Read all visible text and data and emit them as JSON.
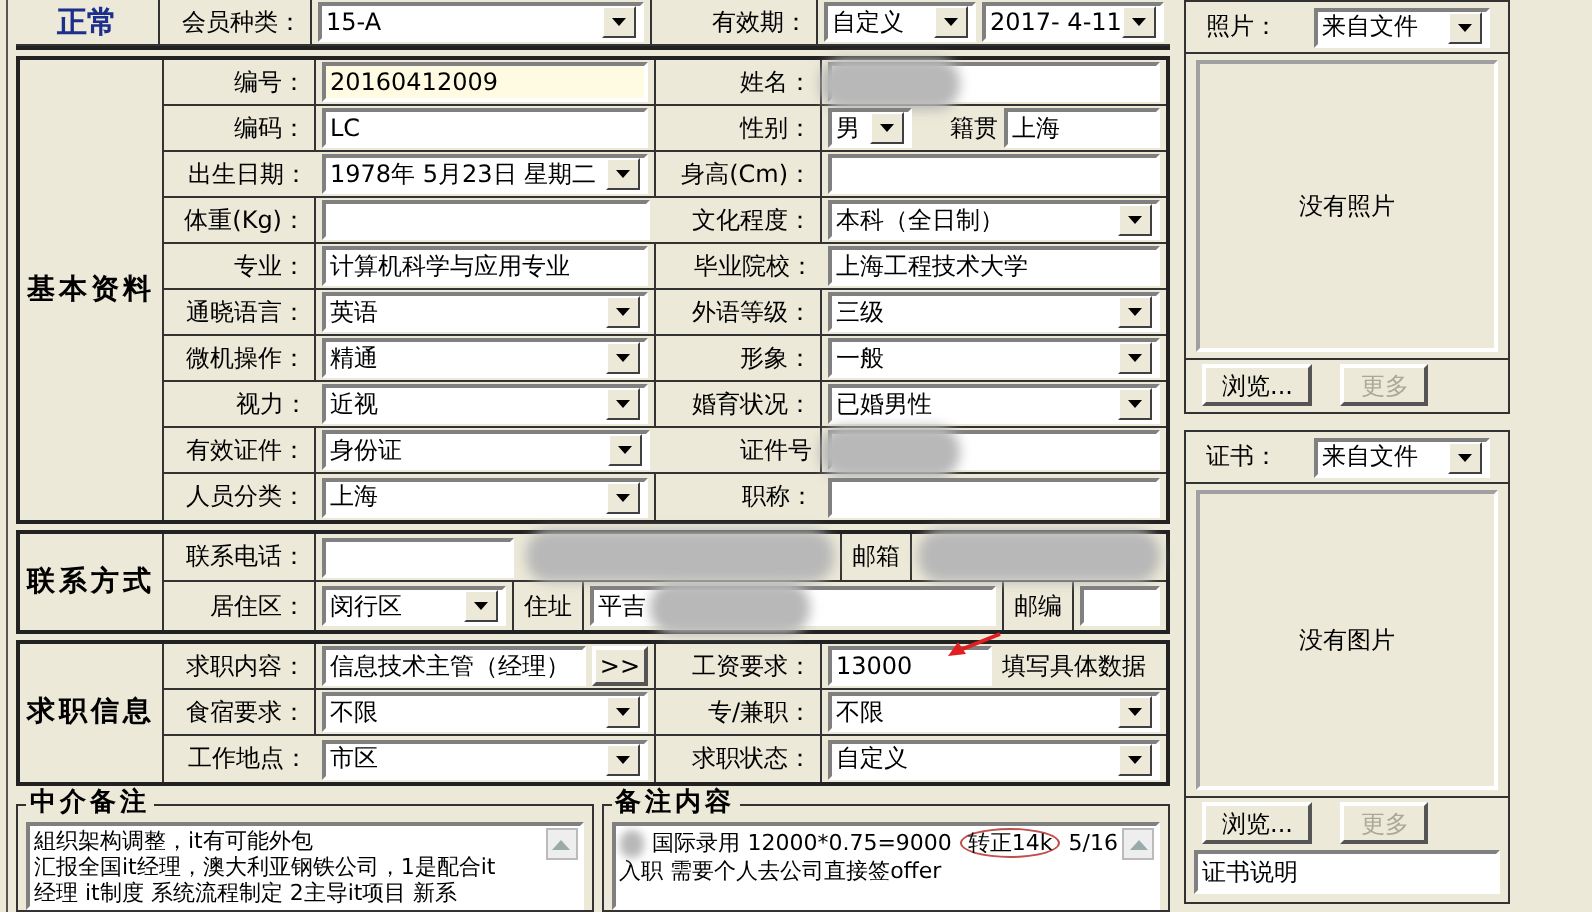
{
  "status": "正常",
  "membership": {
    "label": "会员种类：",
    "value": "15-A"
  },
  "validity": {
    "label": "有效期：",
    "type": "自定义",
    "date": "2017- 4-11"
  },
  "basic": {
    "title": "基本资料",
    "rows": [
      [
        {
          "label": "编号：",
          "kind": "active_text",
          "value": "20160412009"
        },
        {
          "label": "姓名：",
          "kind": "blurred"
        }
      ],
      [
        {
          "label": "编码：",
          "kind": "text",
          "value": "LC"
        },
        {
          "label": "性别：",
          "kind": "gender",
          "value": "男",
          "origin_label": "籍贯",
          "origin": "上海"
        }
      ],
      [
        {
          "label": "出生日期：",
          "kind": "date",
          "value": "1978年 5月23日 星期二"
        },
        {
          "label": "身高(Cm)：",
          "kind": "text"
        }
      ],
      [
        {
          "label": "体重(Kg)：",
          "kind": "text"
        },
        {
          "label": "文化程度：",
          "kind": "select",
          "value": "本科（全日制）"
        }
      ],
      [
        {
          "label": "专业：",
          "kind": "text",
          "value": "计算机科学与应用专业"
        },
        {
          "label": "毕业院校：",
          "kind": "text",
          "value": "上海工程技术大学"
        }
      ],
      [
        {
          "label": "通晓语言：",
          "kind": "select",
          "value": "英语"
        },
        {
          "label": "外语等级：",
          "kind": "select",
          "value": "三级"
        }
      ],
      [
        {
          "label": "微机操作：",
          "kind": "select",
          "value": "精通"
        },
        {
          "label": "形象：",
          "kind": "select",
          "value": "一般"
        }
      ],
      [
        {
          "label": "视力：",
          "kind": "select",
          "value": "近视"
        },
        {
          "label": "婚育状况：",
          "kind": "select",
          "value": "已婚男性"
        }
      ],
      [
        {
          "label": "有效证件：",
          "kind": "select",
          "value": "身份证"
        },
        {
          "label": "证件号",
          "kind": "blurred"
        }
      ],
      [
        {
          "label": "人员分类：",
          "kind": "select",
          "value": "上海"
        },
        {
          "label": "职称：",
          "kind": "text"
        }
      ]
    ]
  },
  "contact": {
    "title": "联系方式",
    "rows": [
      {
        "label": "联系电话：",
        "items": [
          {
            "kind": "text"
          },
          {
            "kind": "blurred"
          },
          {
            "kind": "label",
            "text": "邮箱"
          },
          {
            "kind": "blurred"
          }
        ]
      },
      {
        "label": "居住区：",
        "items": [
          {
            "kind": "select",
            "value": "闵行区"
          },
          {
            "kind": "label",
            "text": "住址"
          },
          {
            "kind": "blurred",
            "value": "平吉"
          },
          {
            "kind": "label",
            "text": "邮编"
          },
          {
            "kind": "text"
          }
        ]
      }
    ]
  },
  "jobs": {
    "title": "求职信息",
    "rows": [
      [
        {
          "label": "求职内容：",
          "kind": "button_field",
          "value": "信息技术主管（经理）",
          "button": ">>"
        },
        {
          "label": "工资要求：",
          "kind": "hint_field",
          "value": "13000",
          "hint": "填写具体数据"
        }
      ],
      [
        {
          "label": "食宿要求：",
          "kind": "select",
          "value": "不限"
        },
        {
          "label": "专/兼职：",
          "kind": "select",
          "value": "不限"
        }
      ],
      [
        {
          "label": "工作地点：",
          "kind": "select",
          "value": "市区"
        },
        {
          "label": "求职状态：",
          "kind": "select",
          "value": "自定义"
        }
      ]
    ]
  },
  "agent_notes": {
    "title": "中介备注",
    "lines": [
      "組织架构调整，it有可能外包",
      "汇报全国it经理，澳大利亚钢铁公司，1是配合it",
      "经理 it制度 系统流程制定  2主导it项目 新系"
    ]
  },
  "remarks": {
    "title": "备注内容",
    "lines": [
      [
        {
          "text": "国际录用 12000*0.75=9000",
          "circled": false
        },
        {
          "text": "转正14k",
          "circled": true
        },
        {
          "text": "5/16",
          "circled": false
        }
      ],
      [
        {
          "text": "入职  需要个人去公司直接签offer",
          "circled": false
        }
      ]
    ]
  },
  "photo": {
    "label": "照片：",
    "source": "来自文件",
    "empty_text": "没有照片",
    "buttons": [
      {
        "label": "浏览...",
        "disabled": false
      },
      {
        "label": "更多",
        "disabled": true
      }
    ]
  },
  "certificate": {
    "label": "证书：",
    "source": "来自文件",
    "empty_text": "没有图片",
    "buttons": [
      {
        "label": "浏览...",
        "disabled": false
      },
      {
        "label": "更多",
        "disabled": true
      }
    ],
    "caption": "证书说明"
  }
}
